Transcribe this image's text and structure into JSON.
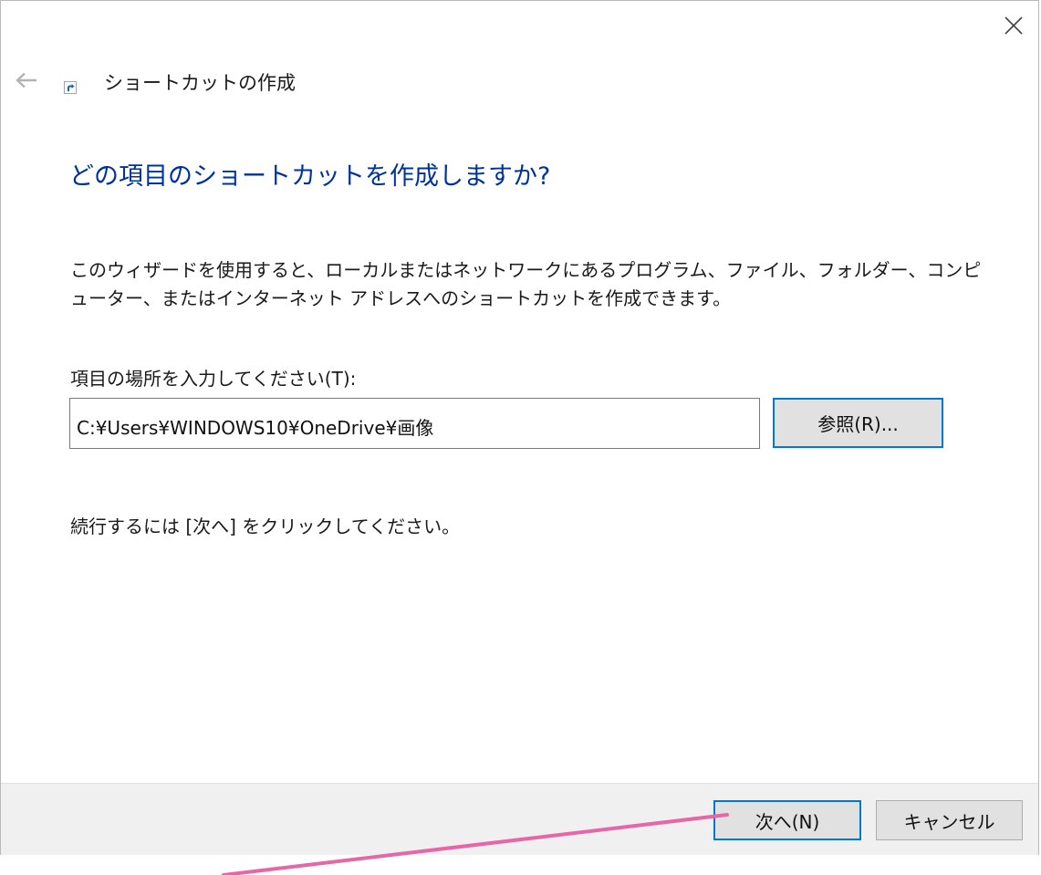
{
  "window": {
    "title": "ショートカットの作成",
    "close_icon": "close-icon",
    "back_icon": "back-arrow-icon",
    "shortcut_icon": "shortcut-arrow-icon"
  },
  "main": {
    "heading": "どの項目のショートカットを作成しますか?",
    "description": "このウィザードを使用すると、ローカルまたはネットワークにあるプログラム、ファイル、フォルダー、コンピューター、またはインターネット アドレスへのショートカットを作成できます。",
    "location_label": "項目の場所を入力してください(T):",
    "location_value": "C:¥Users¥WINDOWS10¥OneDrive¥画像",
    "browse_label": "参照(R)...",
    "continue_text": "続行するには [次へ] をクリックしてください。"
  },
  "footer": {
    "next_label": "次へ(N)",
    "cancel_label": "キャンセル"
  },
  "colors": {
    "heading": "#003399",
    "focus_border": "#0078d7",
    "annotation_line": "#e667a8"
  }
}
